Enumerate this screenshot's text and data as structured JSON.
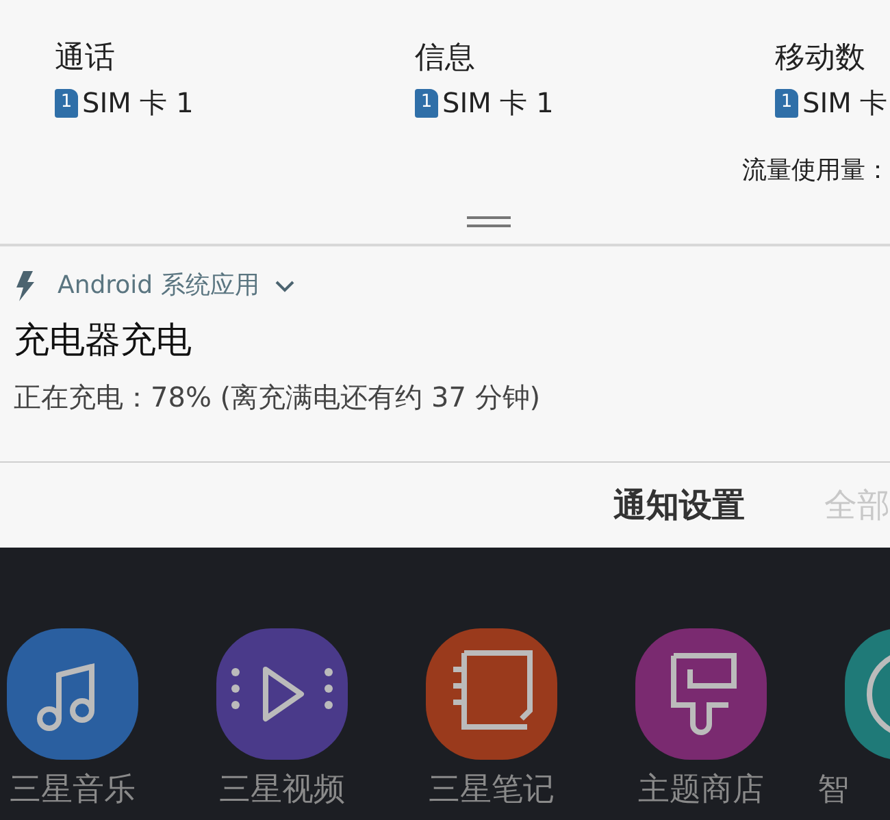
{
  "sim_preferences": [
    {
      "title": "通话",
      "sim_number": "1",
      "sim_label": "SIM 卡 1"
    },
    {
      "title": "信息",
      "sim_number": "1",
      "sim_label": "SIM 卡 1"
    },
    {
      "title": "移动数",
      "sim_number": "1",
      "sim_label": "SIM 卡"
    }
  ],
  "data_usage": "流量使用量：",
  "notification": {
    "app": "Android 系统应用",
    "title": "充电器充电",
    "text": "正在充电：78% (离充满电还有约 37 分钟)"
  },
  "actions": [
    {
      "label": "通知设置",
      "disabled": false
    },
    {
      "label": "全部",
      "disabled": true
    }
  ],
  "apps": [
    {
      "label": "三星音乐",
      "kind": "music",
      "color": "#2a5fa0"
    },
    {
      "label": "三星视频",
      "kind": "video",
      "color": "#4a3a8a"
    },
    {
      "label": "三星笔记",
      "kind": "notes",
      "color": "#9a3a1c"
    },
    {
      "label": "主题商店",
      "kind": "theme",
      "color": "#7a2a70"
    },
    {
      "label": "智",
      "kind": "partial",
      "color": "#1f7a78"
    }
  ]
}
